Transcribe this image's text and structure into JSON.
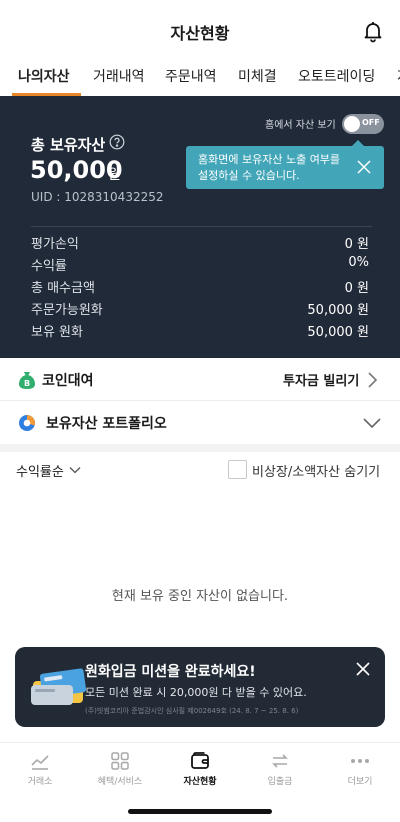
{
  "header": {
    "title": "자산현황"
  },
  "tabs": [
    {
      "label": "나의자산",
      "active": true
    },
    {
      "label": "거래내역",
      "active": false
    },
    {
      "label": "주문내역",
      "active": false
    },
    {
      "label": "미체결",
      "active": false
    },
    {
      "label": "오토트레이딩",
      "active": false
    },
    {
      "label": "지",
      "active": false
    }
  ],
  "assets": {
    "home_toggle_label": "홈에서 자산 보기",
    "toggle_state": "OFF",
    "tooltip_text": "홈화면에 보유자산 노출 여부를 설정하실 수 있습니다.",
    "total_label": "총 보유자산",
    "total_amount": "50,000",
    "total_unit": "원",
    "uid": "UID : 1028310432252",
    "summary": [
      {
        "label": "평가손익",
        "value": "0 원"
      },
      {
        "label": "수익률",
        "value": "0%"
      },
      {
        "label": "총 매수금액",
        "value": "0 원"
      },
      {
        "label": "주문가능원화",
        "value": "50,000 원"
      },
      {
        "label": "보유 원화",
        "value": "50,000 원"
      }
    ]
  },
  "loan": {
    "label": "코인대여",
    "action": "투자금 빌리기"
  },
  "portfolio": {
    "label": "보유자산 포트폴리오"
  },
  "filters": {
    "sort_label": "수익률순",
    "hide_label": "비상장/소액자산 숨기기"
  },
  "empty_message": "현재 보유 중인 자산이 없습니다.",
  "banner": {
    "title": "원화입금 미션을 완료하세요!",
    "description": "모든 미션 완료 시 20,000원 다 받을 수 있어요.",
    "fine_print": "(주)빗썸코리아 준법감시인 심사필 제002649호 (24. 8. 7 ~ 25. 8. 6)"
  },
  "bottom_nav": [
    {
      "label": "거래소",
      "icon": "chart-line-icon",
      "active": false
    },
    {
      "label": "혜택/서비스",
      "icon": "grid-icon",
      "active": false
    },
    {
      "label": "자산현황",
      "icon": "wallet-icon",
      "active": true
    },
    {
      "label": "입출금",
      "icon": "transfer-arrows-icon",
      "active": false
    },
    {
      "label": "더보기",
      "icon": "more-dots-icon",
      "active": false
    }
  ],
  "colors": {
    "accent": "#e8872a",
    "dark_panel": "#212a38",
    "tooltip": "#43a6b8",
    "banner": "#222a36"
  }
}
